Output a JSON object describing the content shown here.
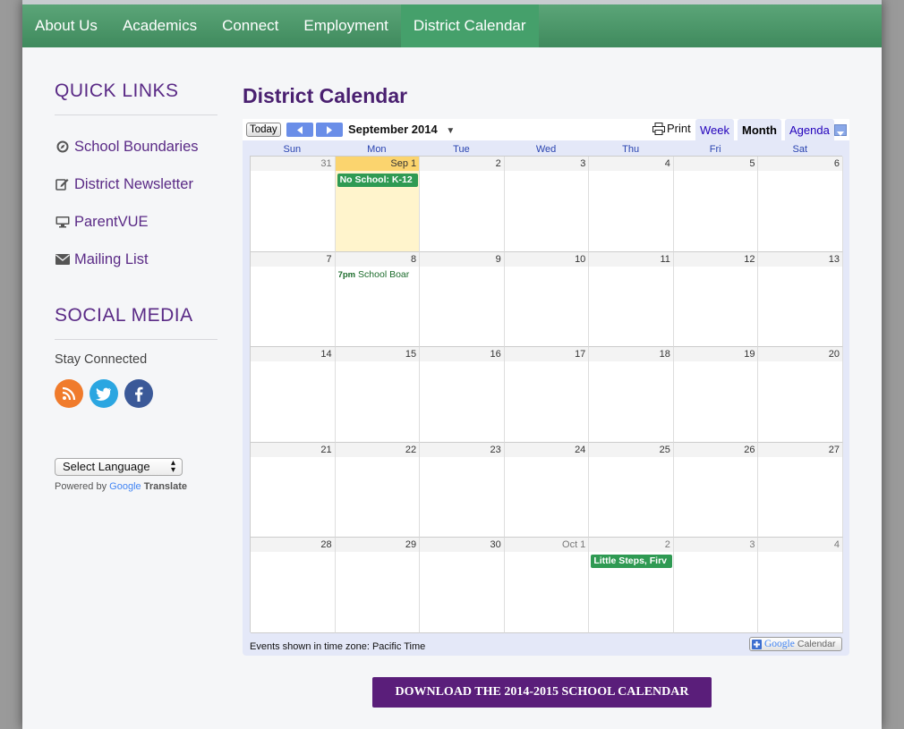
{
  "nav": {
    "items": [
      {
        "label": "About Us"
      },
      {
        "label": "Academics"
      },
      {
        "label": "Connect"
      },
      {
        "label": "Employment"
      },
      {
        "label": "District Calendar"
      }
    ]
  },
  "sidebar": {
    "quick_links_title": "QUICK LINKS",
    "quick_links": [
      {
        "label": "School Boundaries",
        "icon": "compass-icon"
      },
      {
        "label": "District Newsletter",
        "icon": "edit-icon"
      },
      {
        "label": "ParentVUE",
        "icon": "monitor-icon"
      },
      {
        "label": "Mailing List",
        "icon": "envelope-icon"
      }
    ],
    "social_title": "SOCIAL MEDIA",
    "stay_connected": "Stay Connected",
    "social": [
      {
        "icon": "rss-icon",
        "color": "#f07b2c"
      },
      {
        "icon": "twitter-icon",
        "color": "#2ba6e1"
      },
      {
        "icon": "facebook-icon",
        "color": "#3b5998"
      }
    ],
    "language_select": "Select Language",
    "powered_by": "Powered by",
    "google_word": "Google",
    "translate_word": "Translate"
  },
  "main": {
    "title": "District Calendar",
    "download_label": "DOWNLOAD THE 2014-2015 SCHOOL CALENDAR"
  },
  "calendar": {
    "today_label": "Today",
    "month_label": "September 2014",
    "print_label": "Print",
    "views": [
      "Week",
      "Month",
      "Agenda"
    ],
    "active_view": "Month",
    "days_of_week": [
      "Sun",
      "Mon",
      "Tue",
      "Wed",
      "Thu",
      "Fri",
      "Sat"
    ],
    "weeks": [
      [
        {
          "d": "31",
          "other": true
        },
        {
          "d": "Sep 1",
          "today": true
        },
        {
          "d": "2"
        },
        {
          "d": "3"
        },
        {
          "d": "4"
        },
        {
          "d": "5"
        },
        {
          "d": "6"
        }
      ],
      [
        {
          "d": "7"
        },
        {
          "d": "8"
        },
        {
          "d": "9"
        },
        {
          "d": "10"
        },
        {
          "d": "11"
        },
        {
          "d": "12"
        },
        {
          "d": "13"
        }
      ],
      [
        {
          "d": "14"
        },
        {
          "d": "15"
        },
        {
          "d": "16"
        },
        {
          "d": "17"
        },
        {
          "d": "18"
        },
        {
          "d": "19"
        },
        {
          "d": "20"
        }
      ],
      [
        {
          "d": "21"
        },
        {
          "d": "22"
        },
        {
          "d": "23"
        },
        {
          "d": "24"
        },
        {
          "d": "25"
        },
        {
          "d": "26"
        },
        {
          "d": "27"
        }
      ],
      [
        {
          "d": "28"
        },
        {
          "d": "29"
        },
        {
          "d": "30"
        },
        {
          "d": "Oct 1",
          "other": true
        },
        {
          "d": "2",
          "other": true
        },
        {
          "d": "3",
          "other": true
        },
        {
          "d": "4",
          "other": true
        }
      ]
    ],
    "events": [
      {
        "week": 0,
        "day": 1,
        "type": "allday",
        "title": "No School: K-12"
      },
      {
        "week": 1,
        "day": 1,
        "type": "timed",
        "time": "7pm",
        "title": "School Boar"
      },
      {
        "week": 4,
        "day": 4,
        "type": "allday",
        "title": "Little Steps, Firv"
      }
    ],
    "timezone_text": "Events shown in time zone: Pacific Time",
    "gcal_google": "Google",
    "gcal_calendar": "Calendar"
  }
}
